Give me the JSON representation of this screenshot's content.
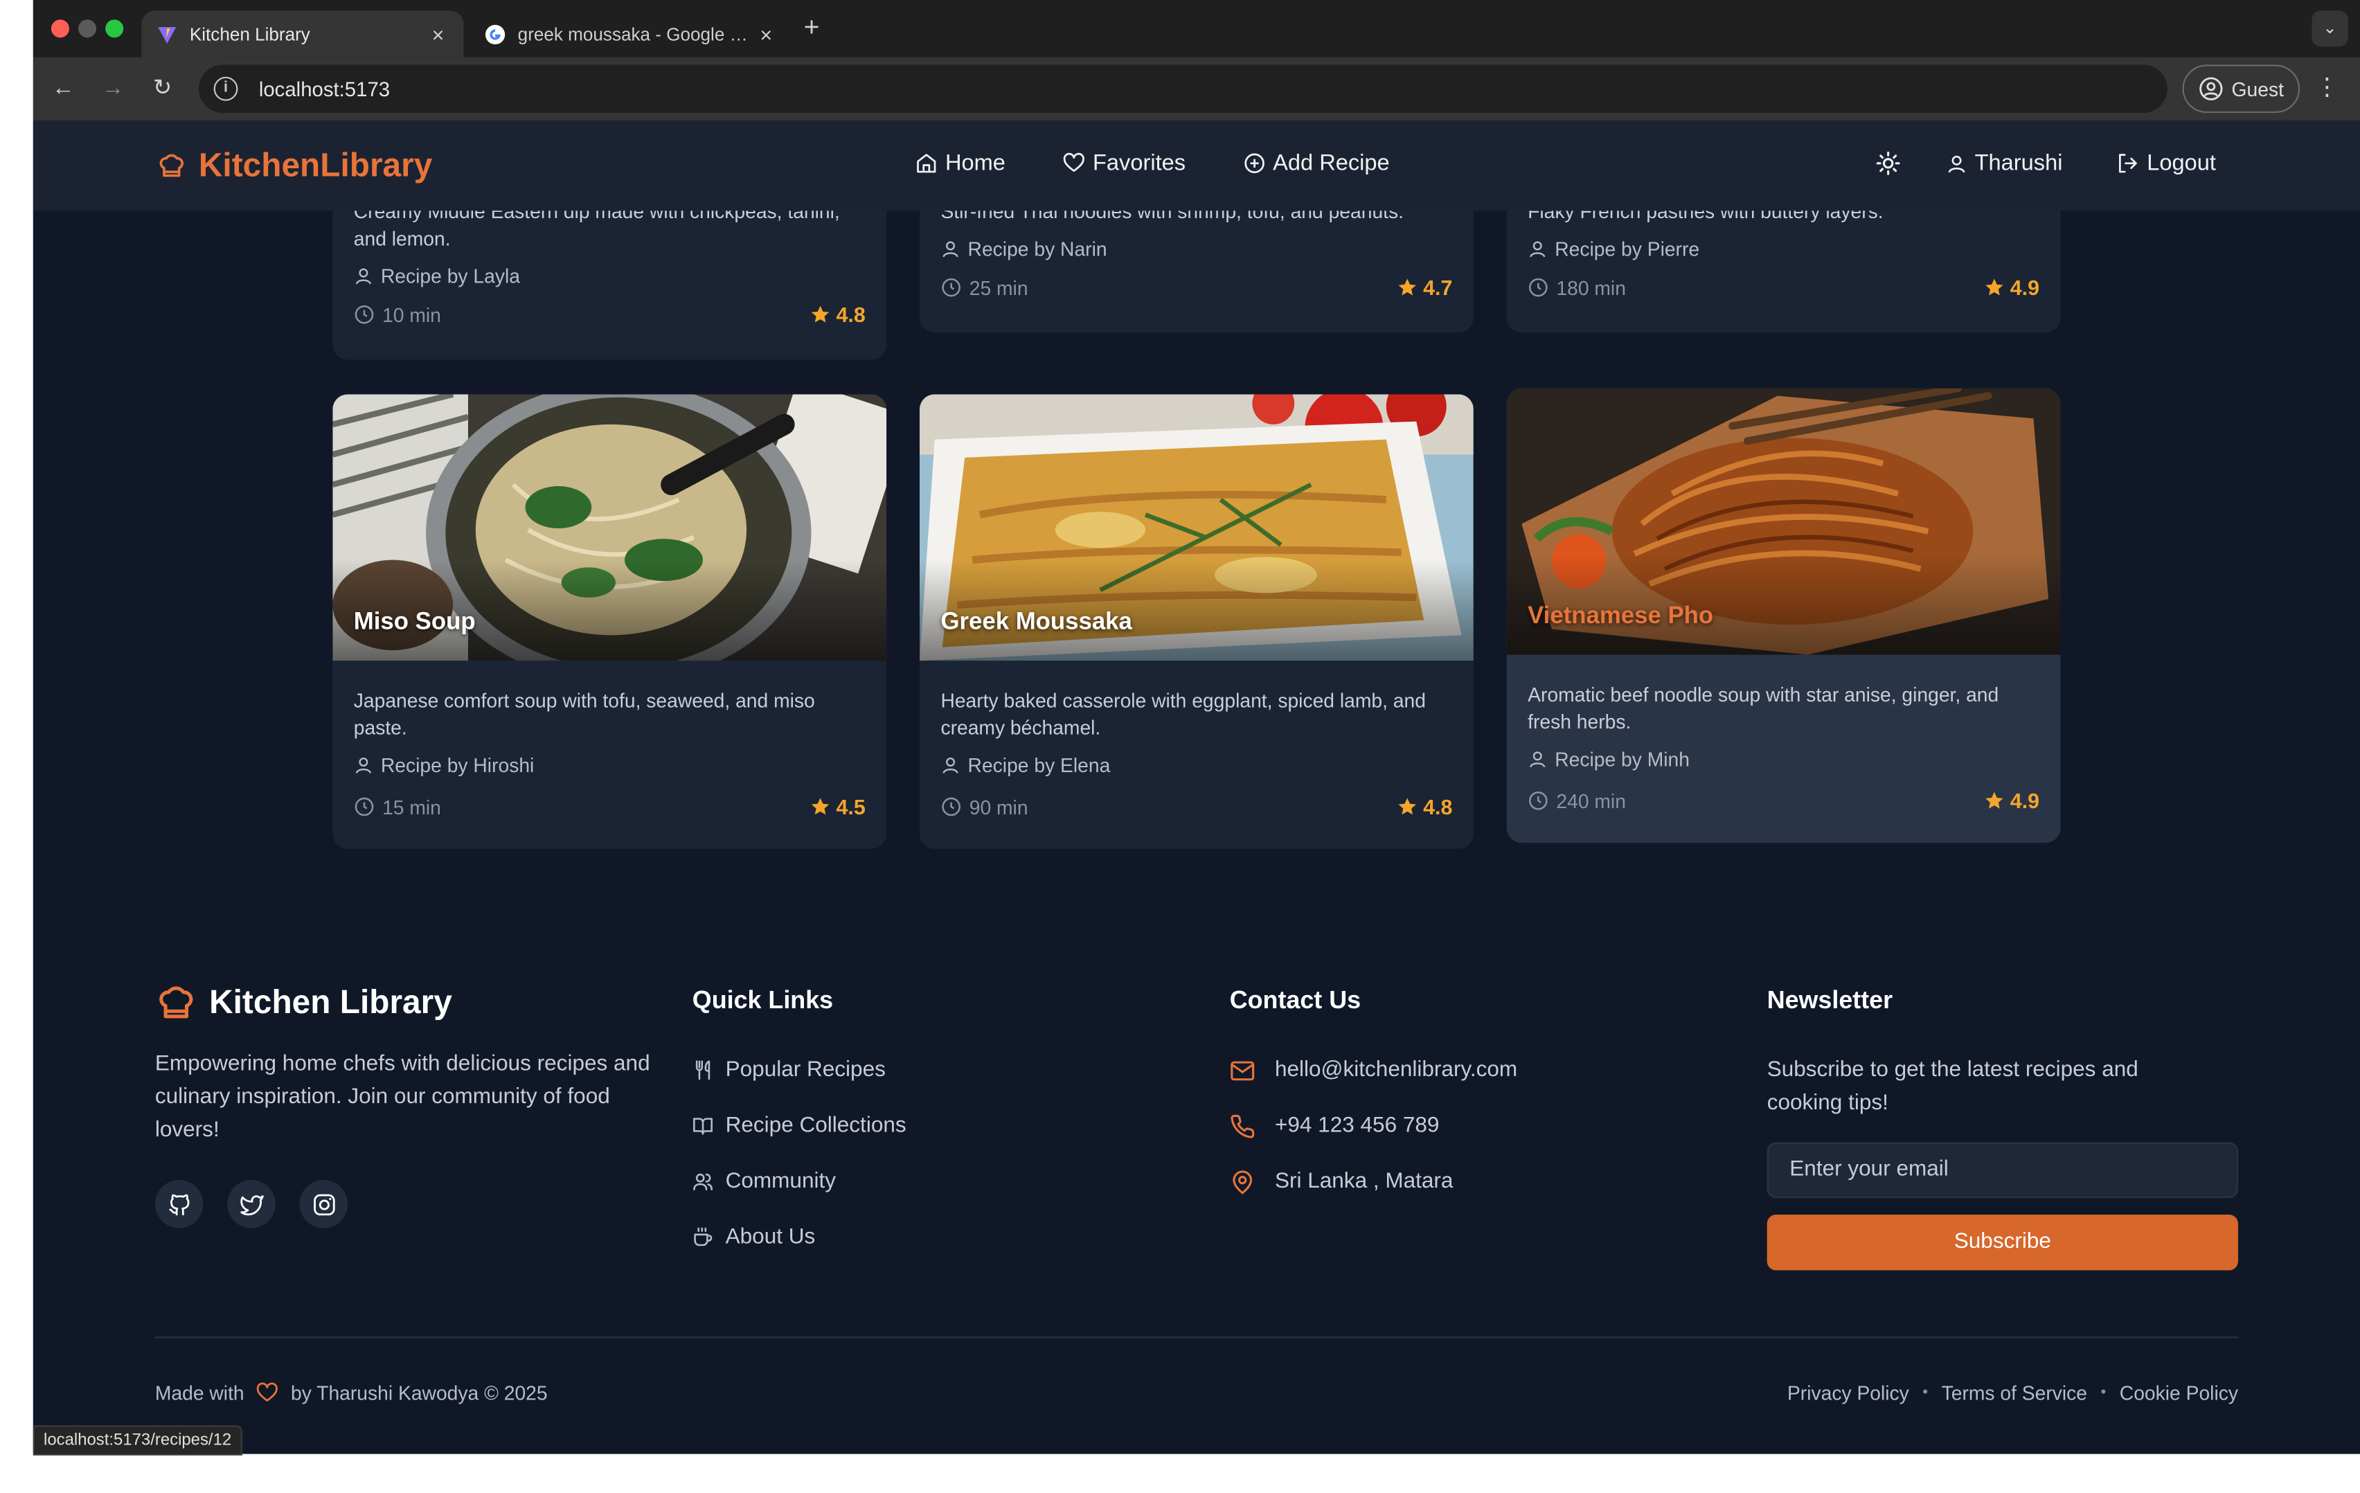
{
  "browser": {
    "tabs": [
      {
        "title": "Kitchen Library",
        "active": true
      },
      {
        "title": "greek moussaka - Google Search",
        "active": false
      }
    ],
    "url": "localhost:5173",
    "profile": "Guest",
    "status_url": "localhost:5173/recipes/12"
  },
  "nav": {
    "brand": "KitchenLibrary",
    "links": [
      "Home",
      "Favorites",
      "Add Recipe"
    ],
    "user": "Tharushi",
    "logout": "Logout"
  },
  "recipes_top": [
    {
      "desc": "Creamy Middle Eastern dip made with chickpeas, tahini, and lemon.",
      "by": "Recipe by Layla",
      "time": "10 min",
      "rating": "4.8"
    },
    {
      "desc": "Stir-fried Thai noodles with shrimp, tofu, and peanuts.",
      "by": "Recipe by Narin",
      "time": "25 min",
      "rating": "4.7"
    },
    {
      "desc": "Flaky French pastries with buttery layers.",
      "by": "Recipe by Pierre",
      "time": "180 min",
      "rating": "4.9"
    }
  ],
  "recipes": [
    {
      "title": "Miso Soup",
      "desc": "Japanese comfort soup with tofu, seaweed, and miso paste.",
      "by": "Recipe by Hiroshi",
      "time": "15 min",
      "rating": "4.5"
    },
    {
      "title": "Greek Moussaka",
      "desc": "Hearty baked casserole with eggplant, spiced lamb, and creamy béchamel.",
      "by": "Recipe by Elena",
      "time": "90 min",
      "rating": "4.8"
    },
    {
      "title": "Vietnamese Pho",
      "desc": "Aromatic beef noodle soup with star anise, ginger, and fresh herbs.",
      "by": "Recipe by Minh",
      "time": "240 min",
      "rating": "4.9"
    }
  ],
  "footer": {
    "brand": "Kitchen Library",
    "tagline": "Empowering home chefs with delicious recipes and culinary inspiration. Join our community of food lovers!",
    "quick_links_heading": "Quick Links",
    "quick_links": [
      "Popular Recipes",
      "Recipe Collections",
      "Community",
      "About Us"
    ],
    "contact_heading": "Contact Us",
    "contact": {
      "email": "hello@kitchenlibrary.com",
      "phone": "+94 123 456 789",
      "location": "Sri Lanka , Matara"
    },
    "newsletter_heading": "Newsletter",
    "newsletter_text": "Subscribe to get the latest recipes and cooking tips!",
    "email_placeholder": "Enter your email",
    "subscribe": "Subscribe",
    "made_with_prefix": "Made with",
    "made_with_suffix": "by Tharushi Kawodya © 2025",
    "legal": [
      "Privacy Policy",
      "Terms of Service",
      "Cookie Policy"
    ]
  },
  "colors": {
    "accent": "#d7672a",
    "star": "#f4a62a",
    "page_bg": "#101828",
    "card_bg": "#1b2434"
  }
}
